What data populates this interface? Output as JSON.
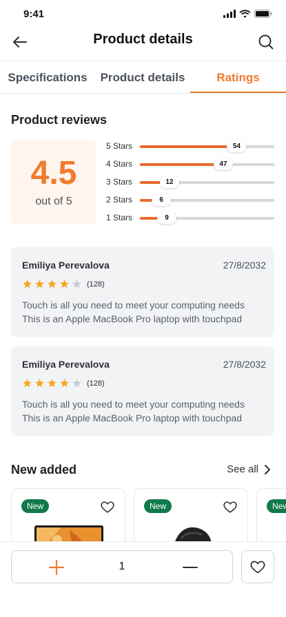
{
  "status_bar": {
    "time": "9:41"
  },
  "header": {
    "title": "Product details"
  },
  "tabs": [
    {
      "label": "Specifications",
      "active": false
    },
    {
      "label": "Product details",
      "active": false
    },
    {
      "label": "Ratings",
      "active": true
    }
  ],
  "reviews_section": {
    "title": "Product reviews",
    "average": "4.5",
    "out_of": "out of 5",
    "breakdown": [
      {
        "label": "5 Stars",
        "count": "54",
        "fill": 0.72
      },
      {
        "label": "4 Stars",
        "count": "47",
        "fill": 0.62
      },
      {
        "label": "3 Stars",
        "count": "12",
        "fill": 0.22
      },
      {
        "label": "2 Stars",
        "count": "6",
        "fill": 0.16
      },
      {
        "label": "1 Stars",
        "count": "9",
        "fill": 0.2
      }
    ]
  },
  "reviews": [
    {
      "name": "Emiliya Perevalova",
      "date": "27/8/2032",
      "stars": 4,
      "count": "(128)",
      "line1": "Touch is all you need to meet your computing needs",
      "line2": "This is an Apple MacBook Pro laptop with touchpad"
    },
    {
      "name": "Emiliya Perevalova",
      "date": "27/8/2032",
      "stars": 4,
      "count": "(128)",
      "line1": "Touch is all you need to meet your computing needs",
      "line2": "This is an Apple MacBook Pro laptop with touchpad"
    }
  ],
  "new_added": {
    "title": "New added",
    "see_all": "See all",
    "products": [
      {
        "badge": "New",
        "image": "laptop"
      },
      {
        "badge": "New",
        "image": "smartwatch"
      },
      {
        "badge": "New",
        "image": "product"
      }
    ]
  },
  "bottom_bar": {
    "quantity": "1"
  },
  "colors": {
    "accent": "#f07b2f",
    "bar_fill": "#e8692a",
    "star": "#f5a623",
    "badge": "#117a4d"
  }
}
